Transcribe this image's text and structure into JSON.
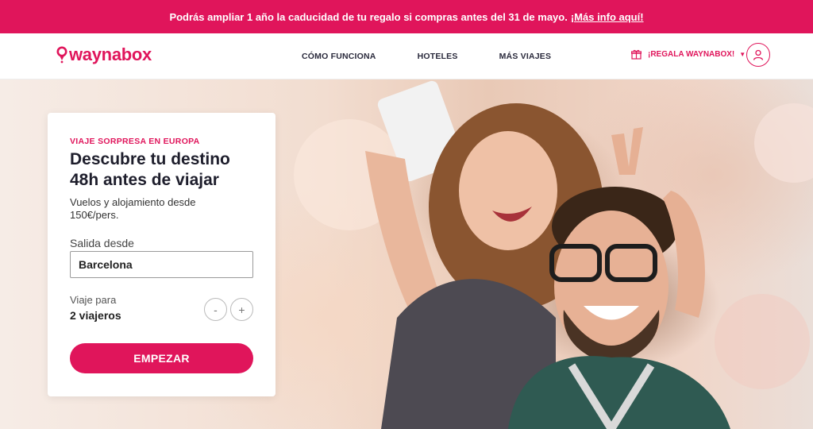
{
  "promo": {
    "text": "Podrás ampliar 1 año la caducidad de tu regalo si compras antes del 31 de mayo.",
    "link": "¡Más info aquí!"
  },
  "header": {
    "logo": "waynabox",
    "nav": [
      "CÓMO FUNCIONA",
      "HOTELES",
      "MÁS VIAJES"
    ],
    "gift_label": "¡REGALA WAYNABOX!"
  },
  "hero": {
    "eyebrow": "VIAJE SORPRESA EN EUROPA",
    "headline": "Descubre tu destino 48h antes de viajar",
    "subtext": "Vuelos y alojamiento desde 150€/pers.",
    "departure_label": "Salida desde",
    "departure_value": "Barcelona",
    "travel_label": "Viaje para",
    "travel_value": "2 viajeros",
    "minus": "-",
    "plus": "+",
    "cta": "EMPEZAR"
  },
  "colors": {
    "brand": "#e0155b"
  }
}
